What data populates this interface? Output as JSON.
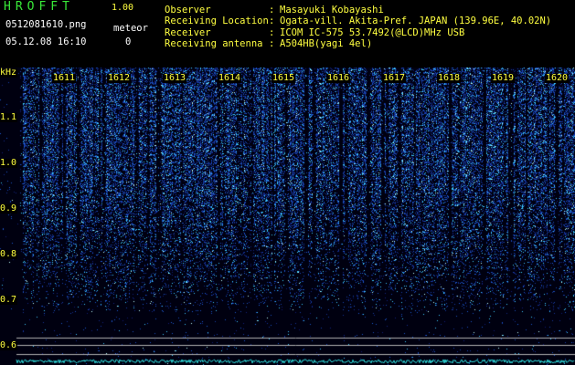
{
  "app": {
    "title": "HROFFT",
    "version": "1.00"
  },
  "file": {
    "name": "0512081610.png",
    "datetime": "05.12.08 16:10"
  },
  "meteor": {
    "label": "meteor",
    "count": "0"
  },
  "info": [
    {
      "label": "Observer",
      "value": "Masayuki Kobayashi"
    },
    {
      "label": "Receiving Location",
      "value": "Ogata-vill. Akita-Pref. JAPAN (139.96E, 40.02N)"
    },
    {
      "label": "Receiver",
      "value": "ICOM IC-575 53.7492(@LCD)MHz USB"
    },
    {
      "label": "Receiving antenna",
      "value": "A504HB(yagi 4el)"
    }
  ],
  "separator": ":",
  "spectrogram": {
    "y_unit": "kHz",
    "y_ticks": [
      "1.1",
      "1.0",
      "0.9",
      "0.8",
      "0.7",
      "0.6"
    ],
    "time_ticks": [
      "1611",
      "1612",
      "1613",
      "1614",
      "1615",
      "1616",
      "1617",
      "1618",
      "1619",
      "1620"
    ],
    "colors": {
      "background": "#000010",
      "signal_low": "#101880",
      "signal_high": "#40a0ff",
      "peak": "#c0ffff",
      "trace": "#30e0e0",
      "reference_line": "#b0b0b0",
      "label": "#ffff40"
    }
  }
}
